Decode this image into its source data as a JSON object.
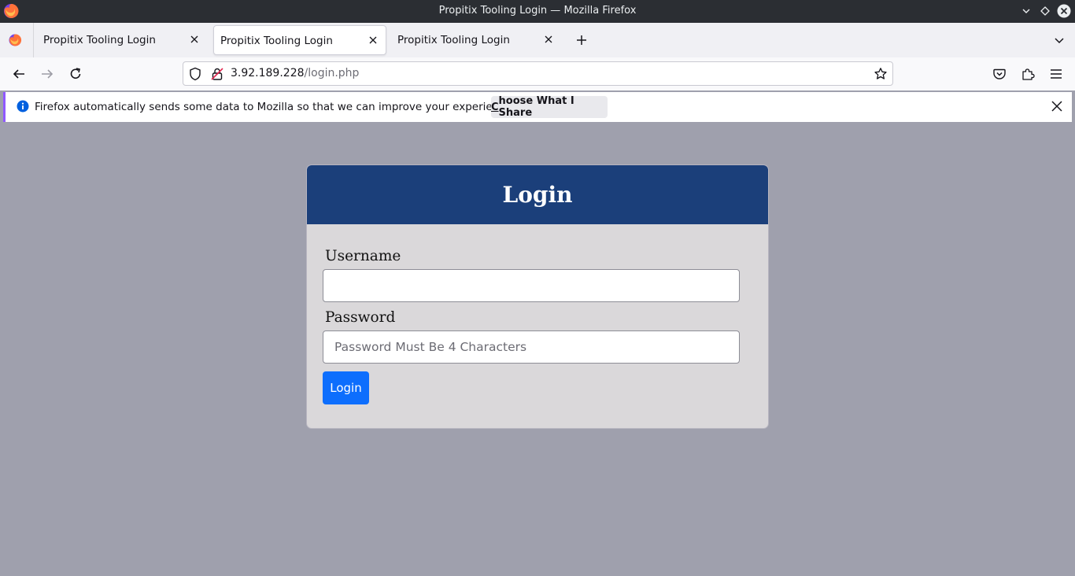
{
  "window": {
    "title": "Propitix Tooling Login — Mozilla Firefox"
  },
  "tabs": [
    {
      "label": "Propitix Tooling Login",
      "active": false
    },
    {
      "label": "Propitix Tooling Login",
      "active": true
    },
    {
      "label": "Propitix Tooling Login",
      "active": false
    }
  ],
  "urlbar": {
    "host": "3.92.189.228",
    "path": "/login.php"
  },
  "notification": {
    "message": "Firefox automatically sends some data to Mozilla so that we can improve your experience.",
    "button_first": "C",
    "button_rest": "hoose What I Share"
  },
  "login": {
    "heading": "Login",
    "username_label": "Username",
    "username_value": "",
    "password_label": "Password",
    "password_placeholder": "Password Must Be 4 Characters",
    "submit_label": "Login"
  },
  "colors": {
    "page_bg": "#9fa0ad",
    "card_bg": "#dad8da",
    "header_bg": "#1b3f7a",
    "button_bg": "#0d6efd",
    "notif_accent": "#9059ff"
  }
}
